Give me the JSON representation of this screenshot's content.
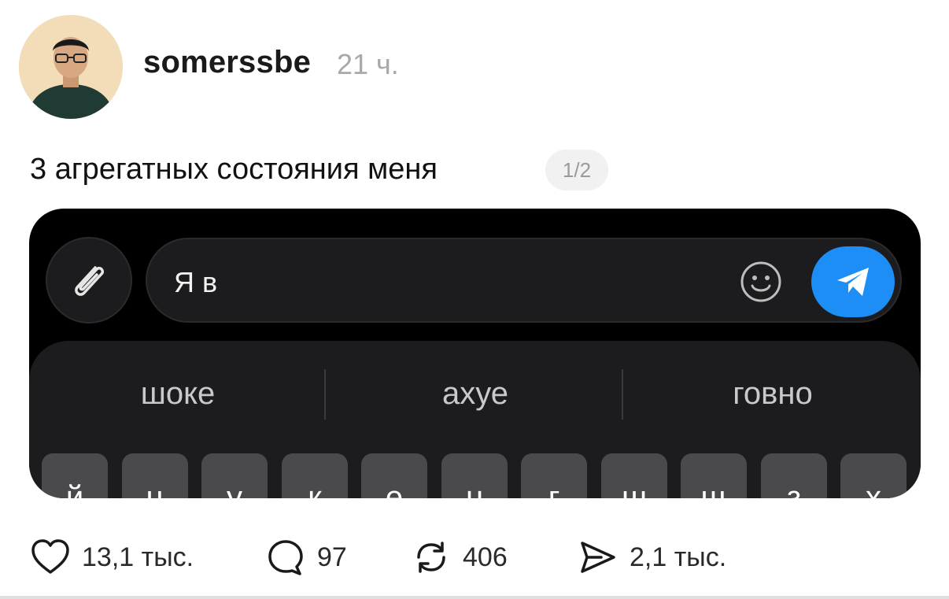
{
  "post": {
    "author": "somerssbe",
    "time": "21 ч.",
    "caption": "3 агрегатных состояния меня",
    "pager": "1/2"
  },
  "media": {
    "input_text": "Я в",
    "suggestions": [
      "шоке",
      "ахуе",
      "говно"
    ],
    "keys": [
      "й",
      "ц",
      "у",
      "к",
      "е",
      "н",
      "г",
      "ш",
      "щ",
      "з",
      "х"
    ],
    "send_color": "#1d8ef5"
  },
  "actions": {
    "likes": "13,1 тыс.",
    "comments": "97",
    "reposts": "406",
    "shares": "2,1 тыс."
  },
  "icons": {
    "avatar": "avatar-photo",
    "attach": "paperclip-icon",
    "emoji": "smiley-icon",
    "send": "paper-plane-icon",
    "like": "heart-icon",
    "comment": "speech-bubble-icon",
    "repost": "repost-icon",
    "share": "share-icon"
  }
}
